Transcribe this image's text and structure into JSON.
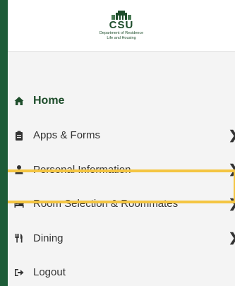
{
  "header": {
    "logo_text": "CSU",
    "logo_line1": "Department of Residence",
    "logo_line2": "Life and Housing"
  },
  "nav": {
    "items": [
      {
        "label": "Home",
        "icon": "home-icon"
      },
      {
        "label": "Apps & Forms",
        "icon": "clipboard-icon"
      },
      {
        "label": "Personal Information",
        "icon": "user-icon"
      },
      {
        "label": "Room Selection & Roommates",
        "icon": "bed-icon"
      },
      {
        "label": "Dining",
        "icon": "utensils-icon"
      },
      {
        "label": "Logout",
        "icon": "logout-icon"
      }
    ],
    "chevron": "❯"
  },
  "colors": {
    "brand_green": "#1e4d2b",
    "highlight": "#f4c542",
    "background": "#1d5c38"
  }
}
